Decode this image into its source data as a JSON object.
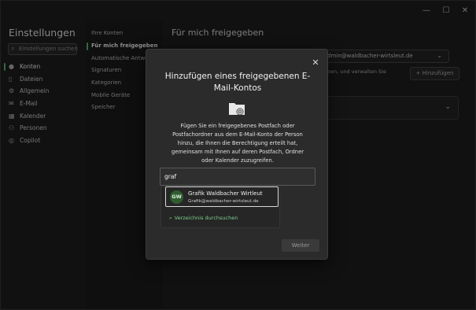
{
  "window": {
    "minimize": "—",
    "maximize": "☐",
    "close": "✕"
  },
  "nav": {
    "title": "Einstellungen",
    "search_placeholder": "Einstellungen suchen",
    "items": [
      {
        "label": "Konten",
        "icon": "person-icon"
      },
      {
        "label": "Dateien",
        "icon": "file-icon"
      },
      {
        "label": "Allgemein",
        "icon": "gear-icon"
      },
      {
        "label": "E-Mail",
        "icon": "mail-icon"
      },
      {
        "label": "Kalender",
        "icon": "calendar-icon"
      },
      {
        "label": "Personen",
        "icon": "people-icon"
      },
      {
        "label": "Copilot",
        "icon": "copilot-icon"
      }
    ]
  },
  "subnav": {
    "items": [
      "Ihre Konten",
      "Für mich freigegeben",
      "Automatische Antwort",
      "Signaturen",
      "Kategorien",
      "Mobile Geräte",
      "Speicher"
    ]
  },
  "content": {
    "title": "Für mich freigegeben",
    "account_value": "dmin@waldbacher-wirtsleut.de",
    "desc_fragment": "r haben, und verwalten Sie",
    "add_label": "+ Hinzufügen"
  },
  "dialog": {
    "title": "Hinzufügen eines freigegebenen E-Mail-Kontos",
    "description": "Fügen Sie ein freigegebenes Postfach oder Postfachordner aus dem E-Mail-Konto der Person hinzu, die Ihnen die Berechtigung erteilt hat, gemeinsam mit Ihnen auf deren Postfach, Ordner oder Kalender zuzugreifen.",
    "search_value": "graf",
    "suggestion": {
      "initials": "GW",
      "name": "Grafik Waldbacher Wirtleut",
      "email": "Grafik@waldbacher-wirtsleut.de"
    },
    "directory_search": "Verzeichnis durchsuchen",
    "next_label": "Weiter",
    "close": "✕"
  },
  "colors": {
    "accent": "#5fb878",
    "dialog_bg": "#2b2b2b",
    "window_bg": "#202020"
  }
}
